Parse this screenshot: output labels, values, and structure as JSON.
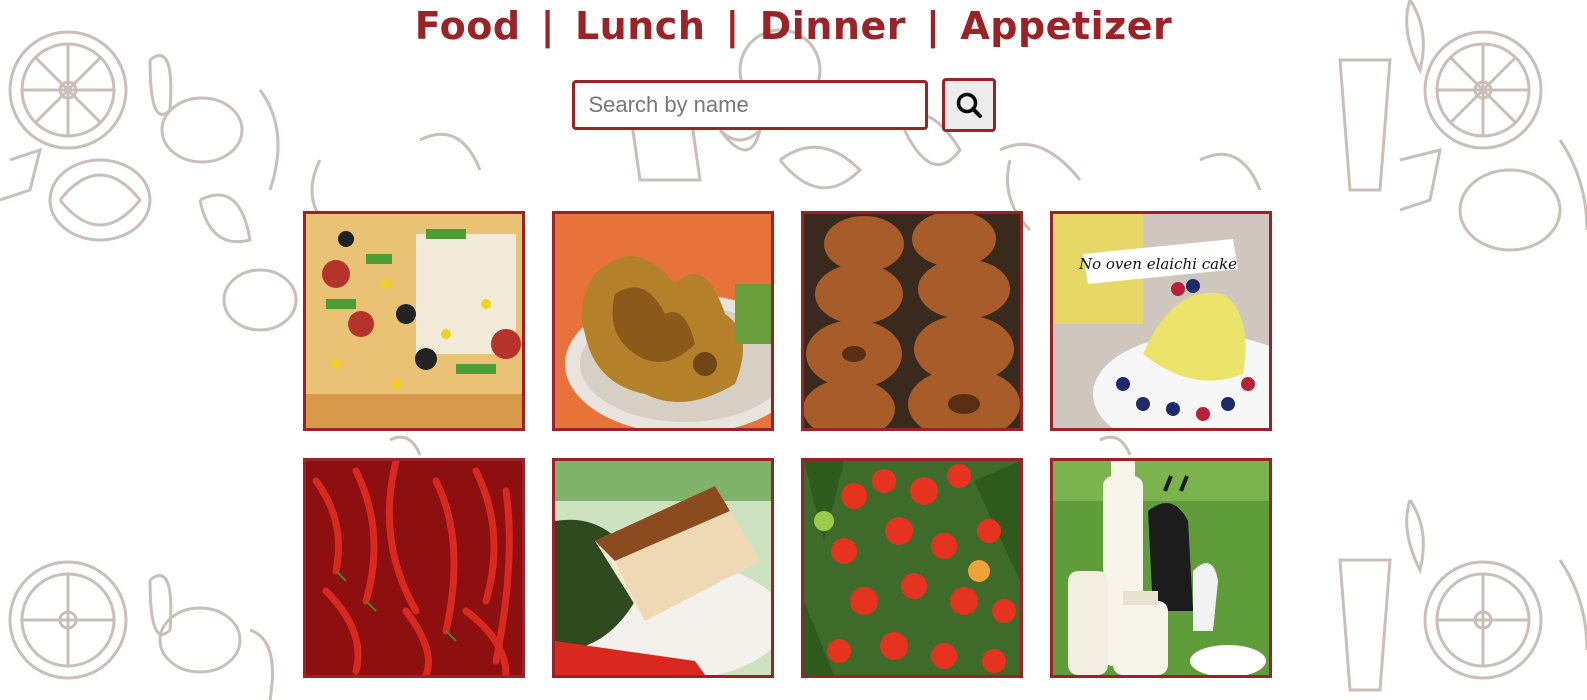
{
  "nav": {
    "items": [
      {
        "label": "Food"
      },
      {
        "label": "Lunch"
      },
      {
        "label": "Dinner"
      },
      {
        "label": "Appetizer"
      }
    ],
    "separator": "|"
  },
  "search": {
    "placeholder": "Search by name",
    "value": "",
    "button_icon": "search-icon"
  },
  "colors": {
    "accent": "#9b2226",
    "button_bg": "#ececec"
  },
  "gallery": {
    "items": [
      {
        "name": "pizza-image"
      },
      {
        "name": "pakora-image"
      },
      {
        "name": "donuts-image"
      },
      {
        "name": "elaichi-cake-image",
        "overlay_text": "No oven elaichi cake"
      },
      {
        "name": "red-chillies-image"
      },
      {
        "name": "paneer-image"
      },
      {
        "name": "cherry-tomatoes-image"
      },
      {
        "name": "goat-milk-image"
      }
    ]
  }
}
